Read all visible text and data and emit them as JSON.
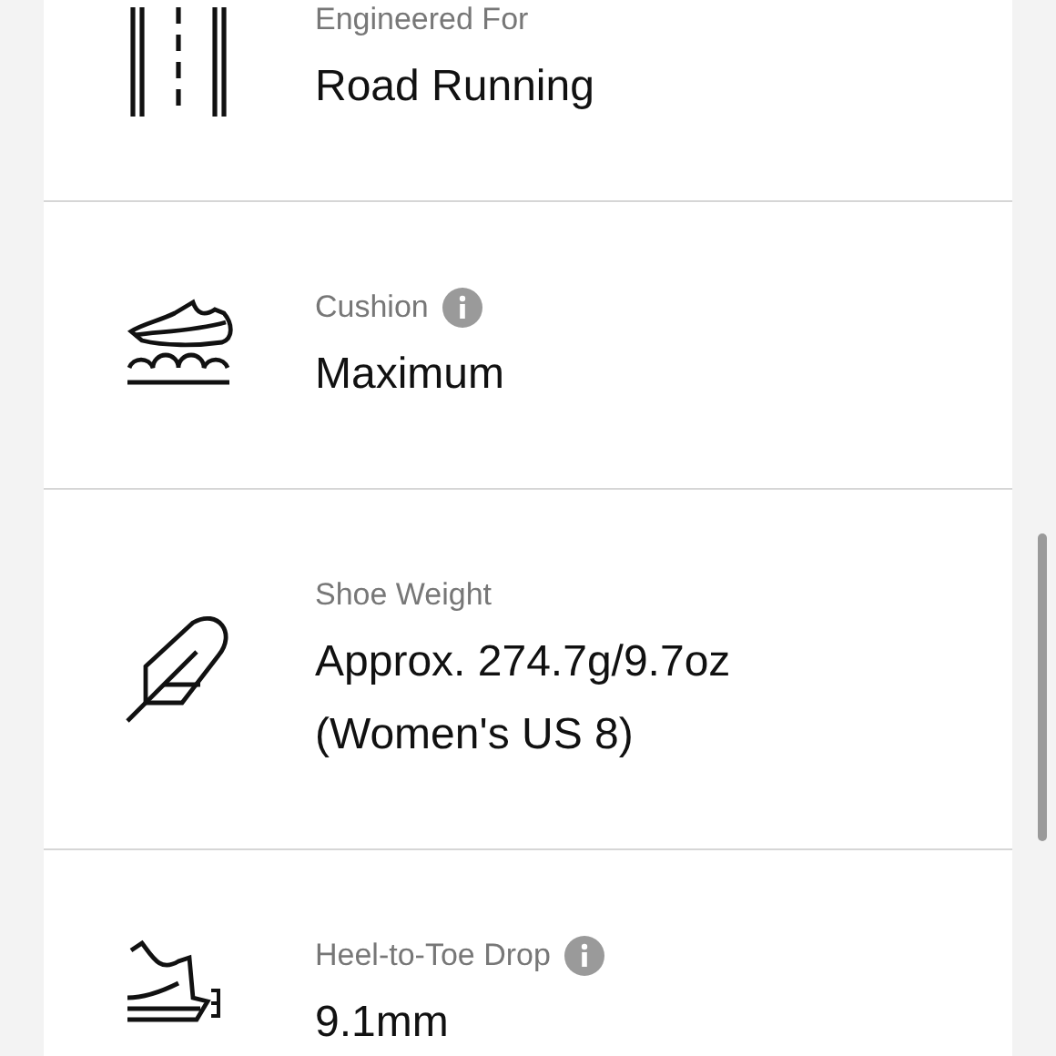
{
  "specs": [
    {
      "kind": "road",
      "label": "Engineered For",
      "info": false,
      "value": [
        "Road Running"
      ]
    },
    {
      "kind": "cushion",
      "label": "Cushion",
      "info": true,
      "value": [
        "Maximum"
      ]
    },
    {
      "kind": "feather",
      "label": "Shoe Weight",
      "info": false,
      "value": [
        "Approx. 274.7g/9.7oz",
        "(Women's US 8)"
      ]
    },
    {
      "kind": "drop",
      "label": "Heel-to-Toe Drop",
      "info": true,
      "value": [
        "9.1mm"
      ]
    }
  ]
}
